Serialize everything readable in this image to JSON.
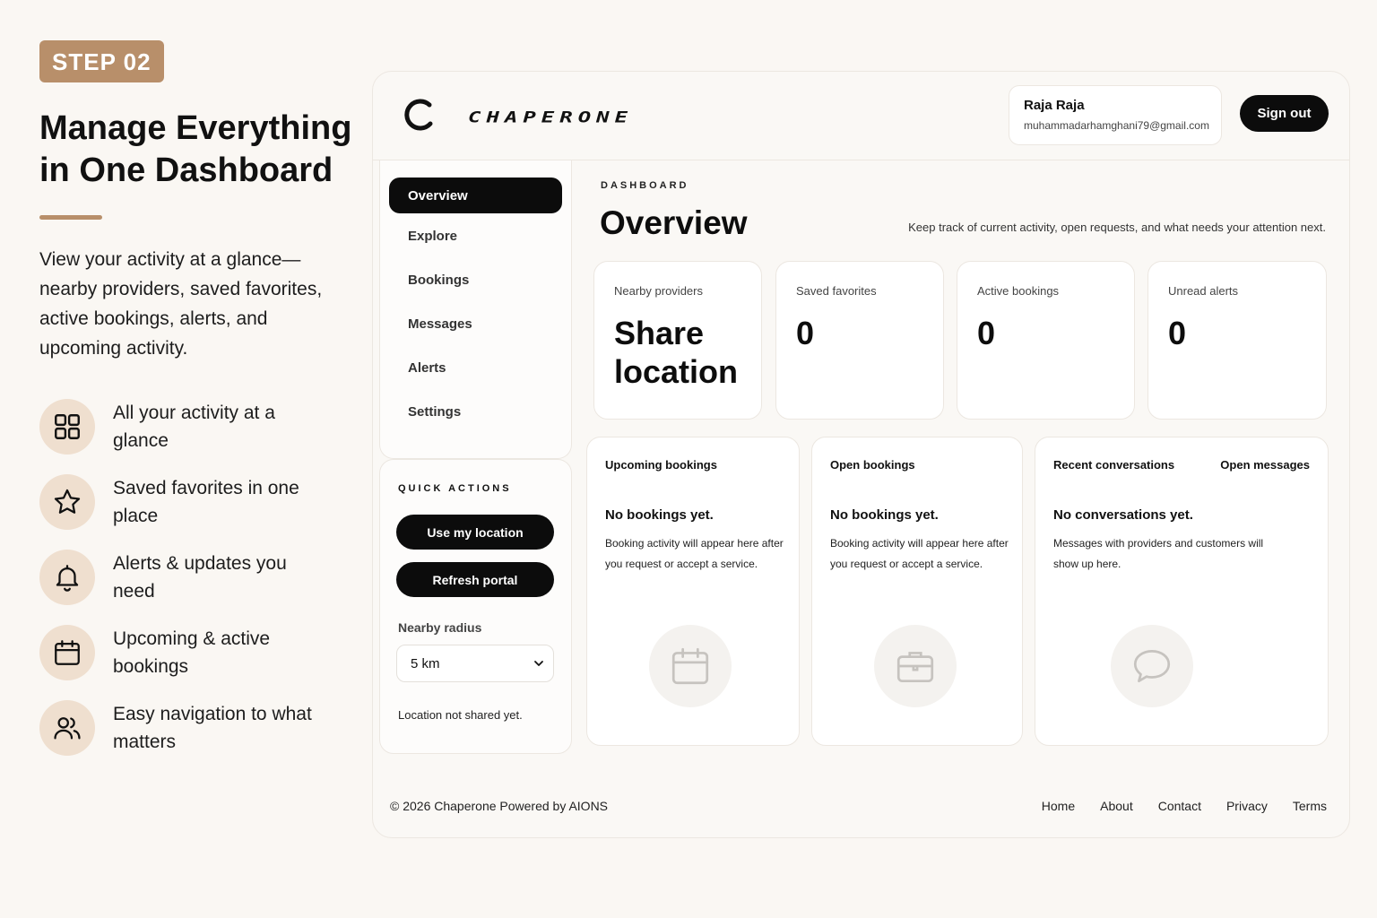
{
  "step": "STEP 02",
  "headline": "Manage Everything in One Dashboard",
  "intro": "View your activity at a glance—nearby providers, saved favorites, active bookings, alerts, and upcoming activity.",
  "features": [
    {
      "icon": "grid-icon",
      "text": "All your activity at a glance"
    },
    {
      "icon": "star-icon",
      "text": "Saved favorites in one place"
    },
    {
      "icon": "bell-icon",
      "text": "Alerts & updates you need"
    },
    {
      "icon": "calendar-icon",
      "text": "Upcoming & active bookings"
    },
    {
      "icon": "users-icon",
      "text": "Easy navigation to what matters"
    }
  ],
  "colors": {
    "accent": "#b88f6a",
    "accent_soft": "#efdfcf",
    "dark": "#0c0c0c",
    "background": "#faf7f3"
  },
  "app": {
    "brand": "CHAPERONE",
    "user": {
      "name": "Raja Raja",
      "email": "muhammadarhamghani79@gmail.com"
    },
    "signout_label": "Sign out",
    "nav": [
      {
        "label": "Overview",
        "active": true
      },
      {
        "label": "Explore"
      },
      {
        "label": "Bookings"
      },
      {
        "label": "Messages"
      },
      {
        "label": "Alerts"
      },
      {
        "label": "Settings"
      }
    ],
    "quick_actions": {
      "title": "QUICK ACTIONS",
      "use_location": "Use my location",
      "refresh": "Refresh portal",
      "radius_label": "Nearby radius",
      "radius_value": "5 km",
      "location_status": "Location not shared yet."
    },
    "main": {
      "eyebrow": "DASHBOARD",
      "title": "Overview",
      "subtitle": "Keep track of current activity, open requests, and what needs your attention next.",
      "stats": [
        {
          "label": "Nearby providers",
          "value": "Share location"
        },
        {
          "label": "Saved favorites",
          "value": "0"
        },
        {
          "label": "Active bookings",
          "value": "0"
        },
        {
          "label": "Unread alerts",
          "value": "0"
        }
      ],
      "panels": [
        {
          "title": "Upcoming bookings",
          "empty": "No bookings yet.",
          "desc": "Booking activity will appear here after you request or accept a service.",
          "icon": "calendar-icon"
        },
        {
          "title": "Open bookings",
          "empty": "No bookings yet.",
          "desc": "Booking activity will appear here after you request or accept a service.",
          "icon": "briefcase-icon"
        },
        {
          "title": "Recent conversations",
          "link": "Open messages",
          "empty": "No conversations yet.",
          "desc": "Messages with providers and customers will show up here.",
          "icon": "chat-bubble-icon"
        }
      ]
    },
    "footer": {
      "copyright": "© 2026 Chaperone Powered by AIONS",
      "links": [
        "Home",
        "About",
        "Contact",
        "Privacy",
        "Terms"
      ]
    }
  }
}
